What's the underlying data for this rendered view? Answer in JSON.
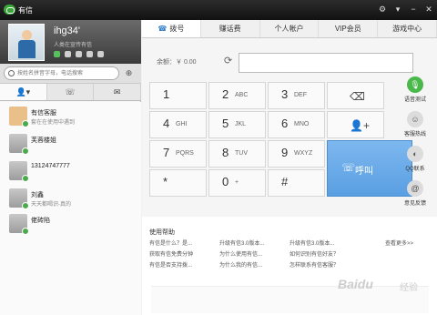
{
  "app": {
    "title": "有信"
  },
  "window_controls": [
    "⚙",
    "▾",
    "−",
    "✕"
  ],
  "profile": {
    "name": "ihg34'",
    "status": "人类在宣传有信"
  },
  "search": {
    "placeholder": "按姓名拼音字母，电话搜索"
  },
  "left_tabs": [
    "contacts-icon",
    "call-log-icon",
    "messages-icon"
  ],
  "contacts": [
    {
      "name": "有信客服",
      "sub": "套在在使用中遇到"
    },
    {
      "name": "芙蓉楼姐",
      "sub": ""
    },
    {
      "name": "13124747777",
      "sub": ""
    },
    {
      "name": "刘鑫",
      "sub": "天天都喝识-真的"
    },
    {
      "name": "佬砖陷",
      "sub": ""
    }
  ],
  "tabs": [
    {
      "label": "拨号",
      "active": true
    },
    {
      "label": "赚话费"
    },
    {
      "label": "个人帐户"
    },
    {
      "label": "VIP会员"
    },
    {
      "label": "游戏中心"
    }
  ],
  "balance": "余额：￥ 0.00",
  "keys": [
    {
      "num": "1",
      "letters": ""
    },
    {
      "num": "2",
      "letters": "ABC"
    },
    {
      "num": "3",
      "letters": "DEF"
    },
    {
      "num": "4",
      "letters": "GHI"
    },
    {
      "num": "5",
      "letters": "JKL"
    },
    {
      "num": "6",
      "letters": "MNO"
    },
    {
      "num": "7",
      "letters": "PQRS"
    },
    {
      "num": "8",
      "letters": "TUV"
    },
    {
      "num": "9",
      "letters": "WXYZ"
    },
    {
      "num": "*",
      "letters": ""
    },
    {
      "num": "0",
      "letters": "+"
    },
    {
      "num": "#",
      "letters": ""
    }
  ],
  "call_label": "呼叫",
  "side_items": [
    {
      "label": "语音测试",
      "icon": "microphone-icon"
    },
    {
      "label": "客服热线",
      "icon": "support-icon"
    },
    {
      "label": "QQ联系",
      "icon": "qq-icon"
    },
    {
      "label": "意见反馈",
      "icon": "feedback-icon"
    }
  ],
  "help": {
    "title": "使用帮助",
    "links": [
      "有信是什么？是...",
      "升级有信3.0版本...",
      "升级有信3.0版本...",
      "获取有信免费分钟",
      "为什么使用有信...",
      "如何识别有信好友？",
      "有信是否支持拨...",
      "为什么我的有信...",
      "怎样联系有信客服？"
    ],
    "more": "查看更多>>"
  },
  "watermark": {
    "brand": "Baidu",
    "sub": "经验"
  },
  "colors": {
    "accent": "#2a79c9",
    "call_button": "#6aaae8",
    "online": "#4aab4a",
    "titlebar": "#1a1a1a"
  }
}
